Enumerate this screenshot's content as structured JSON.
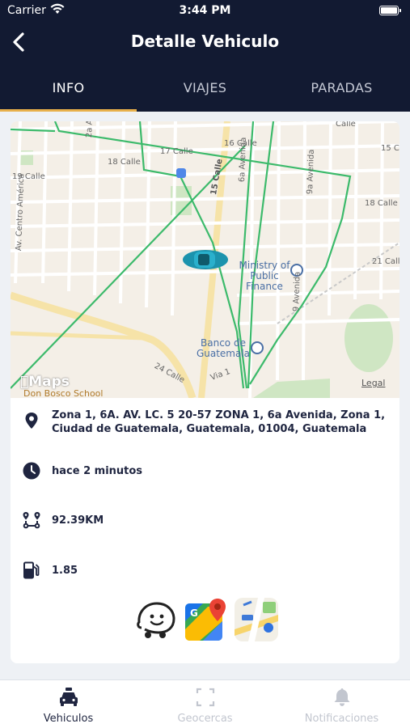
{
  "status_bar": {
    "carrier": "Carrier",
    "time": "3:44 PM"
  },
  "nav": {
    "title": "Detalle Vehiculo"
  },
  "tabs": [
    {
      "label": "INFO",
      "active": true
    },
    {
      "label": "VIAJES",
      "active": false
    },
    {
      "label": "PARADAS",
      "active": false
    }
  ],
  "map": {
    "attribution": "Maps",
    "legal": "Legal",
    "street_labels": [
      "15 Calle",
      "16 Calle",
      "17 Calle",
      "18 Calle",
      "19 Calle",
      "2a Avenida",
      "6a Avenida",
      "9a Avenida",
      "Av. Centro América",
      "18 Calle",
      "21 Calle",
      "24 Calle",
      "Via 1",
      "9 Avenida",
      "15 Ca",
      "Calle"
    ],
    "pois": [
      {
        "name": "Ministry of Public Finance"
      },
      {
        "name": "Banco de Guatemala"
      },
      {
        "name": "Don Bosco School"
      }
    ],
    "route_color": "#3cba6b",
    "vehicle_color": "#1c93ad"
  },
  "info": {
    "address": "Zona 1, 6A. AV. LC. 5 20-57 ZONA 1, 6a Avenida, Zona 1, Ciudad de Guatemala, Guatemala, 01004, Guatemala",
    "last_update": "hace 2 minutos",
    "distance": "92.39KM",
    "fuel": "1.85"
  },
  "apps": [
    {
      "name": "Waze",
      "icon": "waze-icon"
    },
    {
      "name": "Google Maps",
      "icon": "google-maps-icon"
    },
    {
      "name": "Apple Maps",
      "icon": "apple-maps-icon"
    }
  ],
  "tabbar": [
    {
      "label": "Vehiculos",
      "icon": "car-icon",
      "active": true
    },
    {
      "label": "Geocercas",
      "icon": "geofence-icon",
      "active": false
    },
    {
      "label": "Notificaciones",
      "icon": "bell-icon",
      "active": false
    }
  ],
  "colors": {
    "header": "#121a32",
    "accent": "#e8b04b",
    "text_dark": "#1f2540"
  }
}
